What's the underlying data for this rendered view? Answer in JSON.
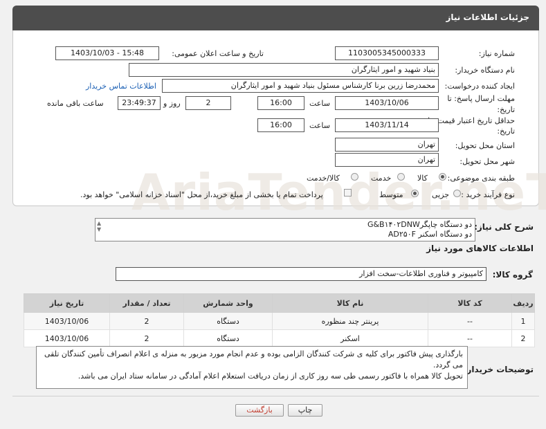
{
  "header": {
    "title": "جزئیات اطلاعات نیاز"
  },
  "fields": {
    "need_number_label": "شماره نیاز:",
    "need_number": "1103005345000333",
    "announce_label": "تاریخ و ساعت اعلان عمومی:",
    "announce_value": "1403/10/03 - 15:48",
    "buyer_org_label": "نام دستگاه خریدار:",
    "buyer_org": "بنیاد شهید و امور ایثارگران",
    "requester_label": "ایجاد کننده درخواست:",
    "requester": "محمدرضا زرین برنا کارشناس مسئول  بنیاد شهید و امور ایثارگران",
    "contact_link": "اطلاعات تماس خریدار",
    "deadline_label_1": "مهلت ارسال پاسخ: تا",
    "deadline_label_2": "تاریخ:",
    "deadline_date": "1403/10/06",
    "time_label": "ساعت",
    "deadline_time": "16:00",
    "days_value": "2",
    "days_label": "روز و",
    "remaining_time": "23:49:37",
    "remaining_label": "ساعت باقی مانده",
    "validity_label_1": "حداقل تاریخ اعتبار قیمت: تا",
    "validity_label_2": "تاریخ:",
    "validity_date": "1403/11/14",
    "validity_time": "16:00",
    "province_label": "استان محل تحویل:",
    "province": "تهران",
    "city_label": "شهر محل تحویل:",
    "city": "تهران",
    "category_label": "طبقه بندی موضوعی:",
    "category_options": [
      "کالا",
      "خدمت",
      "کالا/خدمت"
    ],
    "process_label": "نوع فرآیند خرید :",
    "process_options": [
      "جزیی",
      "متوسط"
    ],
    "payment_note": "پرداخت تمام یا بخشی از مبلغ خرید،از محل \"اسناد خزانه اسلامی\" خواهد بود."
  },
  "summary": {
    "label": "شرح کلی نیاز:",
    "lines": [
      "دو دستگاه چاپگرG&B۱۴۰۲DNW",
      "دو دستگاه اسکنر AD۲۵۰F"
    ]
  },
  "goods": {
    "section_title": "اطلاعات کالاهای مورد نیاز",
    "group_label": "گروه کالا:",
    "group_value": "کامپیوتر و فناوری اطلاعات-سخت افزار",
    "columns": [
      "ردیف",
      "کد کالا",
      "نام کالا",
      "واحد شمارش",
      "تعداد / مقدار",
      "تاریخ نیاز"
    ],
    "rows": [
      [
        "1",
        "--",
        "پرینتر چند منظوره",
        "دستگاه",
        "2",
        "1403/10/06"
      ],
      [
        "2",
        "--",
        "اسکنر",
        "دستگاه",
        "2",
        "1403/10/06"
      ]
    ]
  },
  "notes": {
    "label": "توضیحات خریدار:",
    "text": "بارگذاری پیش فاکتور برای کلیه ی شرکت کنندگان الزامی بوده و عدم انجام مورد مزبور به منزله ی اعلام انصراف تأمین کنندگان تلقی می گردد.\nتحویل کالا همراه با فاکتور رسمی طی سه روز کاری از زمان دریافت استعلام اعلام آمادگی در سامانه ستاد ایران می باشد."
  },
  "buttons": {
    "print": "چاپ",
    "back": "بازگشت"
  },
  "watermark": "AriaTender.neT"
}
